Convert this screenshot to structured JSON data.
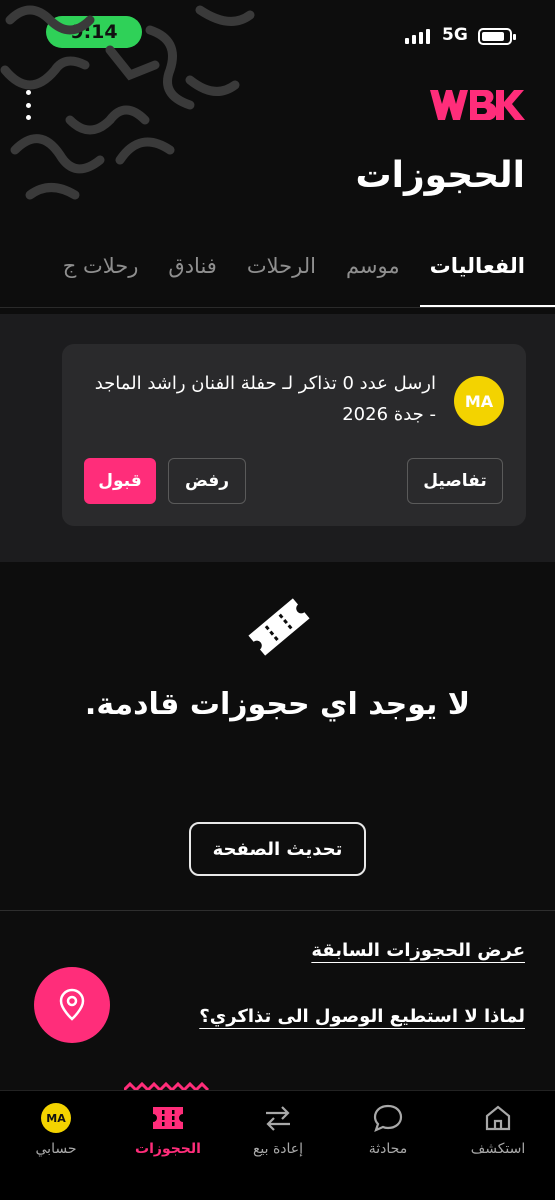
{
  "status_bar": {
    "time": "9:14",
    "network": "5G"
  },
  "header": {
    "title": "الحجوزات",
    "logo_text": "WBK"
  },
  "tabs": [
    {
      "label": "الفعاليات",
      "active": true
    },
    {
      "label": "موسم",
      "active": false
    },
    {
      "label": "الرحلات",
      "active": false
    },
    {
      "label": "فنادق",
      "active": false
    },
    {
      "label": "رحلات ج",
      "active": false
    }
  ],
  "request_card": {
    "avatar_initials": "MA",
    "message": "ارسل عدد 0  تذاكر لـ حفلة الفنان راشد الماجد - جدة 2026",
    "details_label": "تفاصيل",
    "reject_label": "رفض",
    "accept_label": "قبول"
  },
  "empty_state": {
    "message": "لا يوجد اي حجوزات قادمة.",
    "refresh_label": "تحديث الصفحة"
  },
  "links": {
    "past_bookings": "عرض الحجوزات السابقة",
    "why_no_access": "لماذا لا استطيع الوصول الى تذاكري؟"
  },
  "bottom_nav": {
    "explore": "استكشف",
    "chat": "محادثة",
    "resale": "إعادة بيع",
    "bookings": "الحجوزات",
    "account": "حسابي",
    "account_initials": "MA"
  },
  "colors": {
    "accent": "#ff2d7a",
    "avatar": "#f3d300",
    "status_pill": "#2fd158"
  }
}
